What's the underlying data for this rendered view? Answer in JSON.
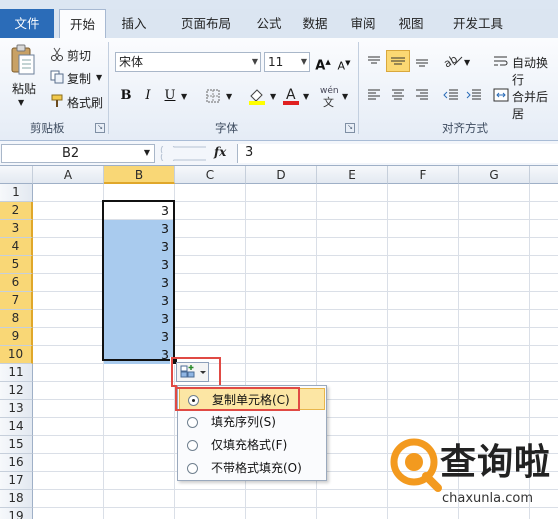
{
  "tabs": [
    "文件",
    "开始",
    "插入",
    "页面布局",
    "公式",
    "数据",
    "审阅",
    "视图",
    "开发工具"
  ],
  "active_tab": "开始",
  "clipboard": {
    "paste": "粘贴",
    "cut": "剪切",
    "copy": "复制",
    "format_painter": "格式刷",
    "group": "剪贴板"
  },
  "font": {
    "name": "宋体",
    "size": "11",
    "bold": "B",
    "italic": "I",
    "underline": "U",
    "group": "字体",
    "phonetic": "wén"
  },
  "alignment": {
    "wrap_text": "自动换行",
    "merge": "合并后居",
    "group": "对齐方式"
  },
  "formula_bar": {
    "name_box": "B2",
    "fx": "fx",
    "value": "3"
  },
  "columns": [
    "A",
    "B",
    "C",
    "D",
    "E",
    "F",
    "G"
  ],
  "selected_column": "B",
  "rows": [
    "1",
    "2",
    "3",
    "4",
    "5",
    "6",
    "7",
    "8",
    "9",
    "10",
    "11",
    "12",
    "13",
    "14",
    "15",
    "16",
    "17",
    "18",
    "19"
  ],
  "cell_values": [
    "3",
    "3",
    "3",
    "3",
    "3",
    "3",
    "3",
    "3",
    "3"
  ],
  "autofill_menu": {
    "options": [
      "复制单元格(C)",
      "填充序列(S)",
      "仅填充格式(F)",
      "不带格式填充(O)"
    ],
    "selected": "复制单元格(C)"
  },
  "watermark": {
    "brand": "查询啦",
    "url": "chaxunla.com"
  },
  "colors": {
    "file_tab": "#2b6cb8",
    "selection_fill": "#a9cbee",
    "header_highlight": "#f9d776",
    "callout": "#e04a44",
    "brand_orange": "#f39a1f"
  }
}
